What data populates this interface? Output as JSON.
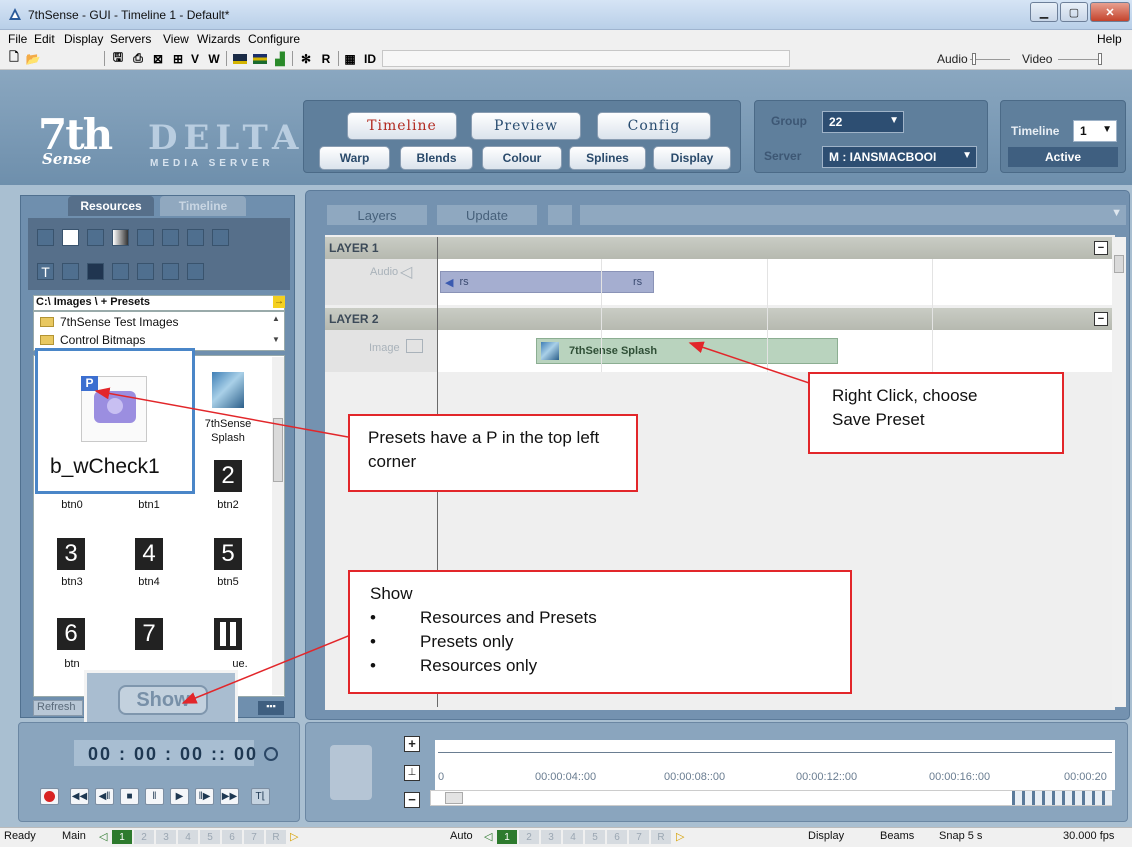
{
  "window": {
    "title": "7thSense -  GUI  - Timeline 1  - Default*"
  },
  "menu": [
    "File",
    "Edit",
    "Display",
    "Servers",
    "View",
    "Wizards",
    "Configure",
    "Help"
  ],
  "toolbar": {
    "v_label": "V",
    "w_label": "W",
    "r_label": "R",
    "id_label": "ID",
    "audio_label": "Audio",
    "video_label": "Video"
  },
  "logo": {
    "main": "7th",
    "sub": "Sense",
    "product": "DELTA",
    "tagline": "MEDIA SERVER"
  },
  "header": {
    "mode_tabs": [
      "Timeline",
      "Preview",
      "Config"
    ],
    "sub_tabs": [
      "Warp",
      "Blends",
      "Colour",
      "Splines",
      "Display"
    ],
    "group_label": "Group",
    "group_value": "22",
    "server_label": "Server",
    "server_value": "M : IANSMACBOOI",
    "timeline_label": "Timeline",
    "timeline_value": "1",
    "active_label": "Active"
  },
  "left": {
    "tabs": [
      "Resources",
      "Timeline"
    ],
    "path": "C:\\ Images \\  + Presets",
    "tree": [
      "7thSense Test Images",
      "Control Bitmaps"
    ],
    "preset_name": "b_wCheck1",
    "preset_badge": "P",
    "items": [
      {
        "label": "btn0",
        "glyph": ""
      },
      {
        "label": "btn1",
        "glyph": ""
      },
      {
        "label": "btn2",
        "glyph": "2"
      },
      {
        "label": "btn3",
        "glyph": "3"
      },
      {
        "label": "btn4",
        "glyph": "4"
      },
      {
        "label": "btn5",
        "glyph": "5"
      },
      {
        "label": "btn",
        "glyph": "6"
      },
      {
        "label": "",
        "glyph": "7"
      },
      {
        "label": "ue.",
        "glyph": ""
      }
    ],
    "splash_label_1": "7thSense",
    "splash_label_2": "Splash",
    "refresh_label": "Refresh",
    "show_label": "Show"
  },
  "timeline": {
    "layers_btn": "Layers",
    "update_btn": "Update",
    "layer1": "LAYER 1",
    "layer2": "LAYER 2",
    "track1_label": "Audio",
    "track2_label": "Image",
    "clip1_left": "rs",
    "clip1_right": "rs",
    "clip2": "7thSense Splash"
  },
  "transport": {
    "timecode": "00 : 00 : 00 :: 00",
    "ruler": [
      "0",
      "00:00:04::00",
      "00:00:08::00",
      "00:00:12::00",
      "00:00:16::00",
      "00:00:20"
    ]
  },
  "status": {
    "ready": "Ready",
    "main": "Main",
    "auto": "Auto",
    "cells": [
      "1",
      "2",
      "3",
      "4",
      "5",
      "6",
      "7",
      "R"
    ],
    "display": "Display",
    "beams": "Beams",
    "snap": "Snap  5 s",
    "fps": "30.000 fps"
  },
  "annotations": {
    "presets_note": "Presets have a P in the top left corner",
    "save_note_1": "Right Click, choose",
    "save_note_2": "Save Preset",
    "show_title": "Show",
    "show_items": [
      "Resources and Presets",
      "Presets only",
      "Resources only"
    ]
  },
  "colors": {
    "accent_red": "#e2262a",
    "panel_blue": "#7492b0",
    "active_green": "#2d7a2d"
  }
}
